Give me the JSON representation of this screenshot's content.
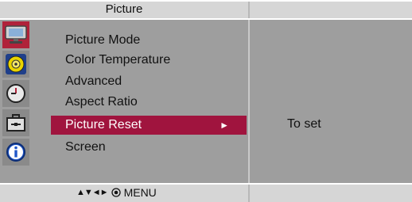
{
  "header": {
    "title": "Picture"
  },
  "sidebar": {
    "icons": [
      {
        "name": "monitor-icon",
        "active": true
      },
      {
        "name": "sound-disc-icon",
        "active": false
      },
      {
        "name": "clock-icon",
        "active": false
      },
      {
        "name": "toolbox-icon",
        "active": false
      },
      {
        "name": "info-icon",
        "active": false
      }
    ]
  },
  "menu": {
    "items": [
      {
        "label": "Picture Mode",
        "selected": false
      },
      {
        "label": "Color Temperature",
        "selected": false
      },
      {
        "label": "Advanced",
        "selected": false
      },
      {
        "label": "Aspect Ratio",
        "selected": false
      },
      {
        "label": "Picture Reset",
        "selected": true,
        "arrow": "►"
      },
      {
        "label": "Screen",
        "selected": false
      }
    ]
  },
  "detail": {
    "value": "To set"
  },
  "footer": {
    "nav_symbols": "▲▼◄►",
    "menu_label": "MENU"
  },
  "colors": {
    "panel": "#9e9e9e",
    "bars": "#d6d6d6",
    "selected": "#a0143e",
    "active_icon": "#b0223a"
  }
}
